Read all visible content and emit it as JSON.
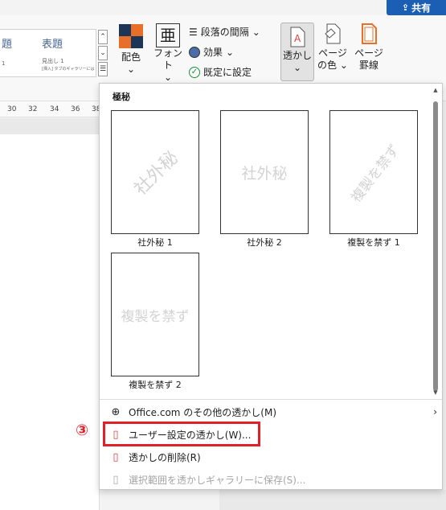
{
  "share_button": {
    "label": "共有",
    "icon": "share-icon"
  },
  "style_gallery": {
    "cells": [
      {
        "title": "題",
        "sub": "1"
      },
      {
        "title": "表題",
        "sub": "見出し 1",
        "note": "[挿入] タブのギャラリーには、文書全"
      }
    ]
  },
  "ribbon": {
    "color_label": "配色",
    "font_label": "フォント",
    "font_icon_text": "亜",
    "paragraph_spacing": "段落の間隔",
    "effects": "効果",
    "set_default": "既定に設定",
    "watermark": "透かし",
    "page_color": [
      "ページ",
      "の色"
    ],
    "page_borders": [
      "ページ",
      "罫線"
    ]
  },
  "ruler": {
    "ticks": [
      "30",
      "32",
      "34",
      "36",
      "38"
    ]
  },
  "watermark_menu": {
    "header": "極秘",
    "items": [
      {
        "text": "社外秘",
        "label": "社外秘 1",
        "style": "diagonal"
      },
      {
        "text": "社外秘",
        "label": "社外秘 2",
        "style": "horizontal"
      },
      {
        "text": "複製を禁ず",
        "label": "複製を禁ず 1",
        "style": "diagonal"
      },
      {
        "text": "複製を禁ず",
        "label": "複製を禁ず 2",
        "style": "horizontal"
      }
    ],
    "commands": {
      "more_online": "Office.com のその他の透かし(M)",
      "custom": "ユーザー設定の透かし(W)...",
      "remove": "透かしの削除(R)",
      "save_selection": "選択範囲を透かしギャラリーに保存(S)..."
    }
  },
  "step_marker": "③",
  "colors": {
    "accent": "#1a5fb4",
    "highlight": "#e0202a",
    "watermark_gray": "#d3d3d3"
  }
}
